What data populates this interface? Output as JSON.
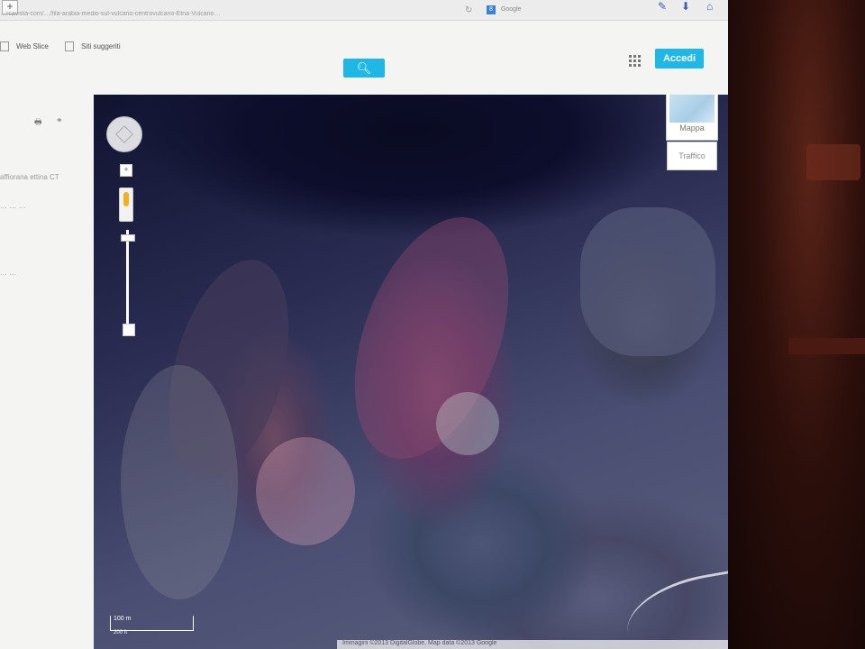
{
  "browser": {
    "new_tab_symbol": "+",
    "url_text": "…rcavista-com/…/fila-arabia-medio-sul-vulcano-centrovulcano-Etna-Vulcano…",
    "search_engine": {
      "badge": "8",
      "label": "Google"
    },
    "reload_symbol": "↻"
  },
  "bookmarks": {
    "items": [
      "Web Slice",
      "Siti suggeriti"
    ]
  },
  "header": {
    "search_button_icon": "search-icon",
    "login_label": "Accedi"
  },
  "sidepanel": {
    "texts": [
      "affiorana ettina CT",
      "… … …",
      "… …"
    ]
  },
  "map": {
    "view": "satellite",
    "maptype_label": "Mappa",
    "traffic_label": "Traffico",
    "scale_label": "100 m",
    "scale_sub": "200 ft",
    "attribution": "Immagini ©2013 DigitalGlobe, Map data ©2013 Google"
  },
  "colors": {
    "accent": "#1fb7e6",
    "pegman": "#f2b01e"
  }
}
